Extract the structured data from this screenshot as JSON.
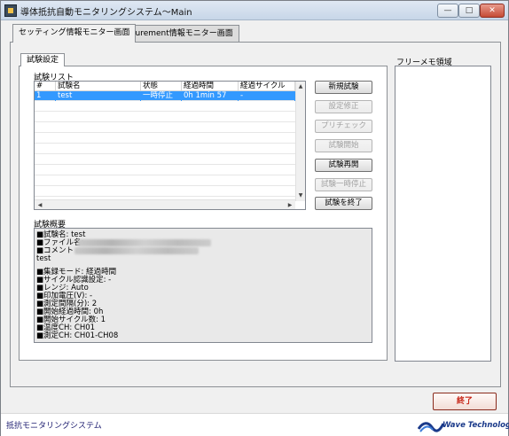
{
  "window": {
    "title": "導体抵抗自動モニタリングシステム～Main",
    "controls": {
      "minimize": "—",
      "maximize": "□",
      "close": "✕"
    }
  },
  "outer_tabs": [
    {
      "label": "セッティング情報モニター画面",
      "active": true
    },
    {
      "label": "Measurement情報モニター画面",
      "active": false
    }
  ],
  "inner_tab": {
    "label": "試験設定"
  },
  "test_list": {
    "label": "試験リスト",
    "columns": [
      "#",
      "試験名",
      "状態",
      "経過時間",
      "経過サイクル"
    ],
    "rows": [
      {
        "cells": [
          "1",
          "test",
          "一時停止",
          "0h 1min 57",
          "-"
        ],
        "selected": true
      }
    ],
    "empty_row_count": 10,
    "scroll_up": "▲",
    "scroll_down": "▼",
    "scroll_left": "◀",
    "scroll_right": "▶"
  },
  "buttons": [
    {
      "label": "新規試験",
      "enabled": true
    },
    {
      "label": "設定修正",
      "enabled": false
    },
    {
      "label": "プリチェック",
      "enabled": false
    },
    {
      "label": "試験開始",
      "enabled": false
    },
    {
      "label": "試験再開",
      "enabled": true
    },
    {
      "label": "試験一時停止",
      "enabled": false
    },
    {
      "label": "試験を終了",
      "enabled": true
    }
  ],
  "summary": {
    "label": "試験概要",
    "lines": [
      "■試験名: test",
      "■ファイル名:",
      "■コメント",
      "test",
      "",
      "■集録モード: 経過時間",
      "■サイクル認識設定: -",
      "■レンジ: Auto",
      "■印加電圧(V): -",
      "■測定間隔(分): 2",
      "■開始経過時間: 0h",
      "■開始サイクル数: 1",
      "■温度CH: CH01",
      "■測定CH: CH01-CH08"
    ]
  },
  "memo": {
    "label": "フリーメモ領域"
  },
  "end_button": {
    "label": "終了"
  },
  "footer": {
    "app_name": "抵抗モニタリングシステム",
    "logo_text": "Wave Technology"
  },
  "colors": {
    "selection": "#3399ff",
    "end_text": "#c8281a",
    "logo": "#1b3a8a"
  }
}
